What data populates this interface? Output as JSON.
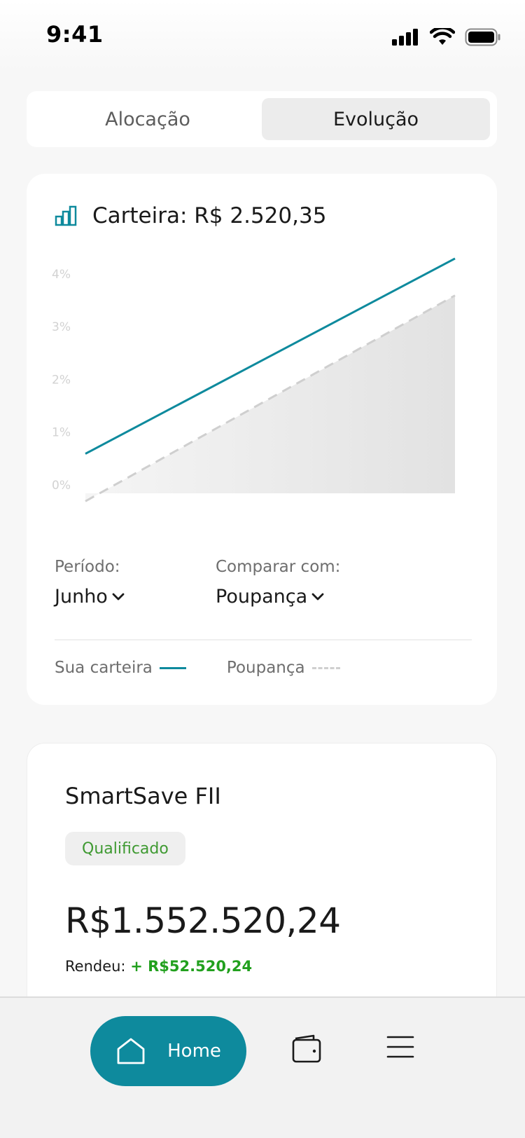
{
  "status_bar": {
    "time": "9:41"
  },
  "tabs": [
    {
      "label": "Alocação",
      "active": false
    },
    {
      "label": "Evolução",
      "active": true
    }
  ],
  "portfolio_card": {
    "title": "Carteira: R$ 2.520,35",
    "period_label": "Período:",
    "period_value": "Junho",
    "compare_label": "Comparar com:",
    "compare_value": "Poupança",
    "legend": [
      {
        "label": "Sua carteira"
      },
      {
        "label": "Poupança"
      }
    ]
  },
  "chart_data": {
    "type": "line",
    "y_ticks": [
      "0%",
      "1%",
      "2%",
      "3%",
      "4%"
    ],
    "ylim": [
      0,
      4
    ],
    "grid": false,
    "series": [
      {
        "name": "Sua carteira",
        "color": "#0e8a9d",
        "style": "solid",
        "start": 0.75,
        "end": 4.45
      },
      {
        "name": "Poupança",
        "color": "#cfcfcf",
        "style": "dashed-filled",
        "start": -0.15,
        "end": 3.75
      }
    ]
  },
  "fund_card": {
    "name": "SmartSave FII",
    "badge": "Qualificado",
    "amount": "R$1.552.520,24",
    "yield_label": "Rendeu:",
    "yield_value": "+ R$52.520,24"
  },
  "bottom_nav": {
    "home_label": "Home",
    "items": [
      "home-icon",
      "wallet-icon",
      "menu-icon"
    ]
  },
  "colors": {
    "accent": "#0e8a9d",
    "positive": "#22a01e",
    "badge_text": "#3f9a32"
  }
}
